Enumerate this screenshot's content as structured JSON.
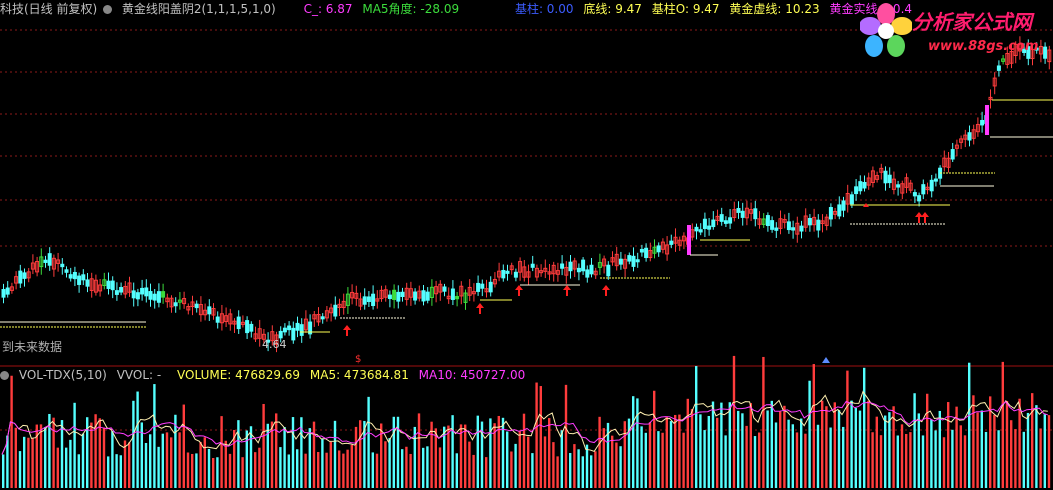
{
  "header": {
    "stock_title": "科技(日线 前复权)",
    "indicator_name": "黄金线阳盖阴2(1,1,1,5,1,0)",
    "c_label": "C_: 6.87",
    "ma5_angle": "MA5角度: -28.09",
    "base_col": "基柱: 0.00",
    "bottom_line": "底线: 9.47",
    "base_col_o": "基柱O: 9.47",
    "gold_dashed": "黄金虚线: 10.23",
    "gold_solid": "黄金实线: 10.4"
  },
  "logo": {
    "title": "分析家公式网",
    "url": "www.88gs.com",
    "flower_icon": "flower-logo-icon"
  },
  "chart": {
    "low_label": "4.64",
    "future_note": "到未来数据"
  },
  "volume": {
    "indicator": "VOL-TDX(5,10)",
    "vvol": "VVOL: -",
    "volume": "VOLUME: 476829.69",
    "ma5": "MA5: 473684.81",
    "ma10": "MA10: 450727.00"
  },
  "colors": {
    "up": "#ff3c3c",
    "down": "#54ffff",
    "green": "#3cdc3c",
    "magenta": "#ff3cff",
    "gold": "#ffff54",
    "grid": "#8b1a1a"
  }
}
